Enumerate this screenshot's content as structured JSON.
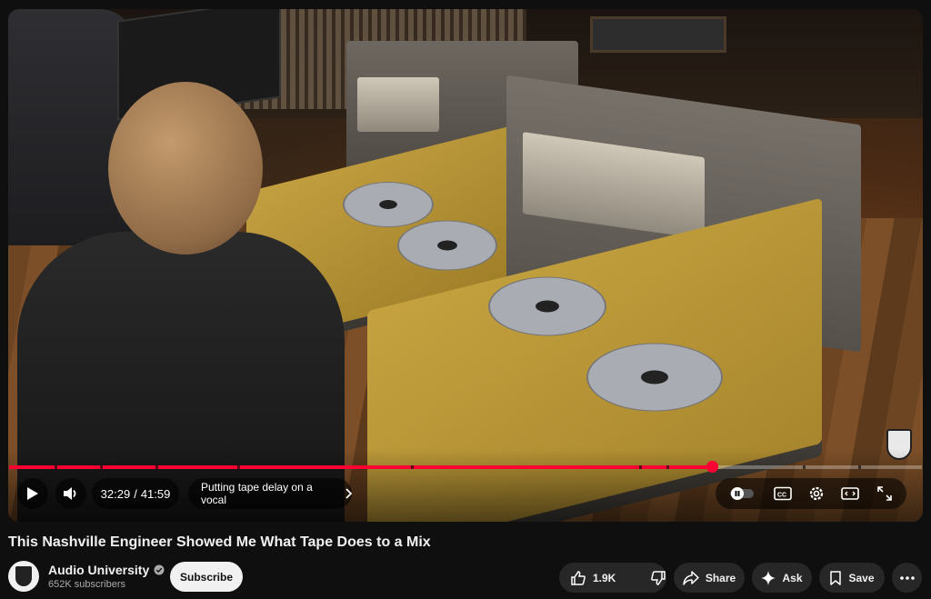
{
  "player": {
    "time_current": "32:29",
    "time_total": "41:59",
    "time_separator": "/",
    "chapter": "Putting tape delay on a vocal",
    "progress_fraction": 0.77,
    "chapter_breaks": [
      0.05,
      0.1,
      0.16,
      0.25,
      0.44,
      0.69,
      0.72,
      0.87,
      0.93
    ],
    "accent_color": "#ff0033",
    "icons": [
      "play-icon",
      "volume-icon",
      "chevron-right-icon",
      "autoplay-toggle-icon",
      "captions-icon",
      "settings-icon",
      "theater-mode-icon",
      "fullscreen-icon"
    ]
  },
  "video": {
    "title": "This Nashville Engineer Showed Me What Tape Does to a Mix"
  },
  "channel": {
    "name": "Audio University",
    "subscribers": "652K subscribers",
    "subscribe_label": "Subscribe"
  },
  "actions": {
    "likes": "1.9K",
    "share_label": "Share",
    "ask_label": "Ask",
    "save_label": "Save"
  },
  "colors": {
    "background": "#0f0f0f",
    "button": "#272727",
    "subscribe_bg": "#f1f1f1"
  }
}
